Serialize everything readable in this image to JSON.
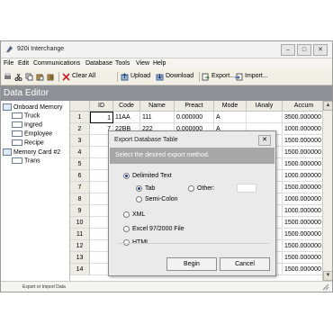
{
  "window": {
    "title": "920i Interchange"
  },
  "menu": [
    "File",
    "Edit",
    "Communications",
    "Database",
    "Tools",
    "View",
    "Help"
  ],
  "toolbar": {
    "clear_all": "Clear All",
    "upload": "Upload",
    "download": "Download",
    "export": "Export...",
    "import": "Import..."
  },
  "section_title": "Data Editor",
  "tree": {
    "onboard": "Onboard Memory",
    "onboard_children": [
      "Truck",
      "Ingred",
      "Employee",
      "Recipe"
    ],
    "memory_card": "Memory Card #2",
    "memory_card_children": [
      "Trans"
    ]
  },
  "grid": {
    "columns": [
      "ID",
      "Code",
      "Name",
      "Preact",
      "Mode",
      "IAnaly",
      "Accum"
    ],
    "rows": [
      {
        "row": "1",
        "cells": [
          "1",
          "11AA",
          "111",
          "0.000000",
          "A",
          "",
          "3500.000000"
        ]
      },
      {
        "row": "2",
        "cells": [
          "7",
          "22BB",
          "222",
          "0.000000",
          "A",
          "",
          "1000.000000"
        ]
      },
      {
        "row": "3",
        "cells": [
          "",
          "",
          "",
          "",
          "",
          "",
          "1500.000000"
        ]
      },
      {
        "row": "4",
        "cells": [
          "",
          "",
          "",
          "",
          "",
          "",
          "1500.000000"
        ]
      },
      {
        "row": "5",
        "cells": [
          "",
          "",
          "",
          "",
          "",
          "",
          "1500.000000"
        ]
      },
      {
        "row": "6",
        "cells": [
          "",
          "",
          "",
          "",
          "",
          "",
          "1000.000000"
        ]
      },
      {
        "row": "7",
        "cells": [
          "",
          "",
          "",
          "",
          "",
          "",
          "1500.000000"
        ]
      },
      {
        "row": "8",
        "cells": [
          "",
          "",
          "",
          "",
          "",
          "",
          "1000.000000"
        ]
      },
      {
        "row": "9",
        "cells": [
          "",
          "",
          "",
          "",
          "",
          "",
          "1000.000000"
        ]
      },
      {
        "row": "10",
        "cells": [
          "",
          "",
          "",
          "",
          "",
          "",
          "1500.000000"
        ]
      },
      {
        "row": "11",
        "cells": [
          "",
          "",
          "",
          "",
          "",
          "",
          "1500.000000"
        ]
      },
      {
        "row": "12",
        "cells": [
          "",
          "",
          "",
          "",
          "",
          "",
          "1500.000000"
        ]
      },
      {
        "row": "13",
        "cells": [
          "",
          "",
          "",
          "",
          "",
          "",
          "1500.000000"
        ]
      },
      {
        "row": "14",
        "cells": [
          "",
          "",
          "",
          "",
          "",
          "",
          "1500.000000"
        ]
      }
    ]
  },
  "status": "Export or Import Data",
  "dialog": {
    "title": "Export Database Table",
    "prompt": "Select the desired export method.",
    "options": {
      "delimited": "Delimited Text",
      "tab": "Tab",
      "other": "Other:",
      "semicolon": "Semi-Colon",
      "xml": "XML",
      "excel": "Excel 97/2000 File",
      "html": "HTML"
    },
    "selected_method": "Delimited Text",
    "selected_delimiter": "Tab",
    "begin": "Begin",
    "cancel": "Cancel"
  },
  "colors": {
    "section_bar": "#8d9096",
    "dialog_band": "#a7a7a7",
    "window_bg": "#ece9d8"
  }
}
